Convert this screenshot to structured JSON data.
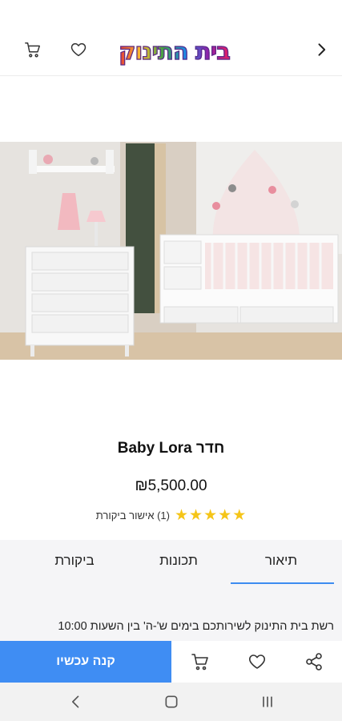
{
  "header": {
    "logo_text": "בית התינוק",
    "icons": {
      "cart": "cart-icon",
      "wishlist": "heart-icon",
      "back": "chevron-right-icon"
    }
  },
  "product": {
    "title": "חדר Baby Lora",
    "price": "₪5,500.00",
    "rating": 5,
    "rating_max": 5,
    "reviews_text": "(1) אישור ביקורת"
  },
  "tabs": {
    "items": [
      {
        "label": "תיאור",
        "active": true
      },
      {
        "label": "תכונות",
        "active": false
      },
      {
        "label": "ביקורת",
        "active": false
      }
    ]
  },
  "description": {
    "text": "רשת בית התינוק לשירותכם בימים ש'-ה' בין השעות 10:00"
  },
  "bottom_bar": {
    "buy_label": "קנה עכשיו",
    "icons": {
      "share": "share-icon",
      "wishlist": "heart-icon",
      "cart": "cart-icon"
    }
  },
  "colors": {
    "accent": "#3f8df3",
    "star": "#f5c518",
    "tabs_background": "#f5f5f7"
  }
}
